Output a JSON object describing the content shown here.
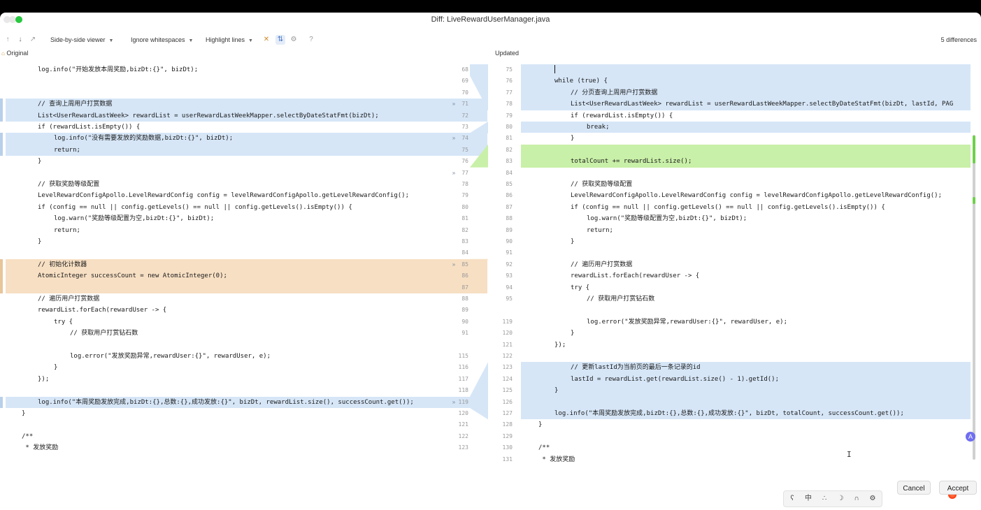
{
  "window": {
    "title": "Diff: LiveRewardUserManager.java"
  },
  "toolbar": {
    "viewer": "Side-by-side viewer",
    "whitespace": "Ignore whitespaces",
    "highlight": "Highlight lines",
    "differences": "5 differences",
    "icons": [
      "up-arrow-icon",
      "down-arrow-icon",
      "jump-icon",
      "collapse-icon",
      "sync-scroll-icon",
      "gear-icon",
      "help-icon"
    ]
  },
  "left_header": "Original",
  "right_header": "Updated",
  "left_lines": [
    {
      "n": "68",
      "code": "log.info(\"开始发放本周奖励,bizDt:{}\", bizDt);",
      "indent": 2,
      "hl": ""
    },
    {
      "n": "69",
      "code": "",
      "indent": 0,
      "hl": ""
    },
    {
      "n": "70",
      "code": "",
      "indent": 0,
      "hl": ""
    },
    {
      "n": "71",
      "code": "// 查询上周用户打赏数据",
      "indent": 2,
      "hl": "blue",
      "mark": "»"
    },
    {
      "n": "72",
      "code": "List<UserRewardLastWeek> rewardList = userRewardLastWeekMapper.selectByDateStatFmt(bizDt);",
      "indent": 2,
      "hl": "blue"
    },
    {
      "n": "73",
      "code": "if (rewardList.isEmpty()) {",
      "indent": 2,
      "hl": ""
    },
    {
      "n": "74",
      "code": "log.info(\"没有需要发放的奖励数据,bizDt:{}\", bizDt);",
      "indent": 3,
      "hl": "blue",
      "mark": "»"
    },
    {
      "n": "75",
      "code": "return;",
      "indent": 3,
      "hl": "blue"
    },
    {
      "n": "76",
      "code": "}",
      "indent": 2,
      "hl": ""
    },
    {
      "n": "77",
      "code": "",
      "indent": 0,
      "hl": "",
      "mark": "»"
    },
    {
      "n": "78",
      "code": "// 获取奖励等级配置",
      "indent": 2,
      "hl": ""
    },
    {
      "n": "79",
      "code": "LevelRewardConfigApollo.LevelRewardConfig config = levelRewardConfigApollo.getLevelRewardConfig();",
      "indent": 2,
      "hl": ""
    },
    {
      "n": "80",
      "code": "if (config == null || config.getLevels() == null || config.getLevels().isEmpty()) {",
      "indent": 2,
      "hl": ""
    },
    {
      "n": "81",
      "code": "log.warn(\"奖励等级配置为空,bizDt:{}\", bizDt);",
      "indent": 3,
      "hl": ""
    },
    {
      "n": "82",
      "code": "return;",
      "indent": 3,
      "hl": ""
    },
    {
      "n": "83",
      "code": "}",
      "indent": 2,
      "hl": ""
    },
    {
      "n": "84",
      "code": "",
      "indent": 0,
      "hl": ""
    },
    {
      "n": "85",
      "code": "// 初始化计数器",
      "indent": 2,
      "hl": "orange",
      "mark": "»"
    },
    {
      "n": "86",
      "code": "AtomicInteger successCount = new AtomicInteger(0);",
      "indent": 2,
      "hl": "orange"
    },
    {
      "n": "87",
      "code": "",
      "indent": 0,
      "hl": "orange"
    },
    {
      "n": "88",
      "code": "// 遍历用户打赏数据",
      "indent": 2,
      "hl": ""
    },
    {
      "n": "89",
      "code": "rewardList.forEach(rewardUser -> {",
      "indent": 2,
      "hl": ""
    },
    {
      "n": "90",
      "code": "try {",
      "indent": 3,
      "hl": ""
    },
    {
      "n": "91",
      "code": "// 获取用户打赏钻石数",
      "indent": 4,
      "hl": ""
    },
    {
      "n": "",
      "code": "",
      "indent": 0,
      "hl": ""
    },
    {
      "n": "115",
      "code": "log.error(\"发放奖励异常,rewardUser:{}\", rewardUser, e);",
      "indent": 4,
      "hl": ""
    },
    {
      "n": "116",
      "code": "}",
      "indent": 3,
      "hl": ""
    },
    {
      "n": "117",
      "code": "});",
      "indent": 2,
      "hl": ""
    },
    {
      "n": "118",
      "code": "",
      "indent": 0,
      "hl": ""
    },
    {
      "n": "119",
      "code": "log.info(\"本周奖励发放完成,bizDt:{},总数:{},成功发放:{}\", bizDt, rewardList.size(), successCount.get());",
      "indent": 2,
      "hl": "blue",
      "mark": "»"
    },
    {
      "n": "120",
      "code": "}",
      "indent": 1,
      "hl": ""
    },
    {
      "n": "121",
      "code": "",
      "indent": 0,
      "hl": ""
    },
    {
      "n": "122",
      "code": "/**",
      "indent": 1,
      "hl": ""
    },
    {
      "n": "123",
      "code": " * 发放奖励",
      "indent": 1,
      "hl": ""
    }
  ],
  "right_lines": [
    {
      "n": "75",
      "code": "",
      "indent": 2,
      "hl": "blue"
    },
    {
      "n": "76",
      "code": "while (true) {",
      "indent": 2,
      "hl": "blue"
    },
    {
      "n": "77",
      "code": "// 分页查询上周用户打赏数据",
      "indent": 3,
      "hl": "blue"
    },
    {
      "n": "78",
      "code": "List<UserRewardLastWeek> rewardList = userRewardLastWeekMapper.selectByDateStatFmt(bizDt, lastId, PAG",
      "indent": 3,
      "hl": "blue"
    },
    {
      "n": "79",
      "code": "if (rewardList.isEmpty()) {",
      "indent": 3,
      "hl": ""
    },
    {
      "n": "80",
      "code": "break;",
      "indent": 4,
      "hl": "blue"
    },
    {
      "n": "81",
      "code": "}",
      "indent": 3,
      "hl": ""
    },
    {
      "n": "82",
      "code": "",
      "indent": 0,
      "hl": "green"
    },
    {
      "n": "83",
      "code": "totalCount += rewardList.size();",
      "indent": 3,
      "hl": "green"
    },
    {
      "n": "84",
      "code": "",
      "indent": 0,
      "hl": ""
    },
    {
      "n": "85",
      "code": "// 获取奖励等级配置",
      "indent": 3,
      "hl": ""
    },
    {
      "n": "86",
      "code": "LevelRewardConfigApollo.LevelRewardConfig config = levelRewardConfigApollo.getLevelRewardConfig();",
      "indent": 3,
      "hl": ""
    },
    {
      "n": "87",
      "code": "if (config == null || config.getLevels() == null || config.getLevels().isEmpty()) {",
      "indent": 3,
      "hl": ""
    },
    {
      "n": "88",
      "code": "log.warn(\"奖励等级配置为空,bizDt:{}\", bizDt);",
      "indent": 4,
      "hl": ""
    },
    {
      "n": "89",
      "code": "return;",
      "indent": 4,
      "hl": ""
    },
    {
      "n": "90",
      "code": "}",
      "indent": 3,
      "hl": ""
    },
    {
      "n": "91",
      "code": "",
      "indent": 0,
      "hl": ""
    },
    {
      "n": "92",
      "code": "// 遍历用户打赏数据",
      "indent": 3,
      "hl": ""
    },
    {
      "n": "93",
      "code": "rewardList.forEach(rewardUser -> {",
      "indent": 3,
      "hl": ""
    },
    {
      "n": "94",
      "code": "try {",
      "indent": 3,
      "hl": ""
    },
    {
      "n": "95",
      "code": "// 获取用户打赏钻石数",
      "indent": 4,
      "hl": ""
    },
    {
      "n": "",
      "code": "",
      "indent": 0,
      "hl": ""
    },
    {
      "n": "119",
      "code": "log.error(\"发放奖励异常,rewardUser:{}\", rewardUser, e);",
      "indent": 4,
      "hl": ""
    },
    {
      "n": "120",
      "code": "}",
      "indent": 3,
      "hl": ""
    },
    {
      "n": "121",
      "code": "});",
      "indent": 2,
      "hl": ""
    },
    {
      "n": "122",
      "code": "",
      "indent": 0,
      "hl": ""
    },
    {
      "n": "123",
      "code": "// 更新lastId为当前页的最后一条记录的id",
      "indent": 3,
      "hl": "blue"
    },
    {
      "n": "124",
      "code": "lastId = rewardList.get(rewardList.size() - 1).getId();",
      "indent": 3,
      "hl": "blue"
    },
    {
      "n": "125",
      "code": "}",
      "indent": 2,
      "hl": "blue"
    },
    {
      "n": "126",
      "code": "",
      "indent": 0,
      "hl": "blue"
    },
    {
      "n": "127",
      "code": "log.info(\"本周奖励发放完成,bizDt:{},总数:{},成功发放:{}\", bizDt, totalCount, successCount.get());",
      "indent": 2,
      "hl": "blue"
    },
    {
      "n": "128",
      "code": "}",
      "indent": 1,
      "hl": ""
    },
    {
      "n": "129",
      "code": "",
      "indent": 0,
      "hl": ""
    },
    {
      "n": "130",
      "code": "/**",
      "indent": 1,
      "hl": ""
    },
    {
      "n": "131",
      "code": " * 发放奖励",
      "indent": 1,
      "hl": ""
    }
  ],
  "bottom_icons": [
    "bear-icon",
    "中",
    "dots-icon",
    "moon-icon",
    "headphones-icon",
    "gear-icon"
  ],
  "buttons": {
    "cancel": "Cancel",
    "accept": "Accept"
  }
}
